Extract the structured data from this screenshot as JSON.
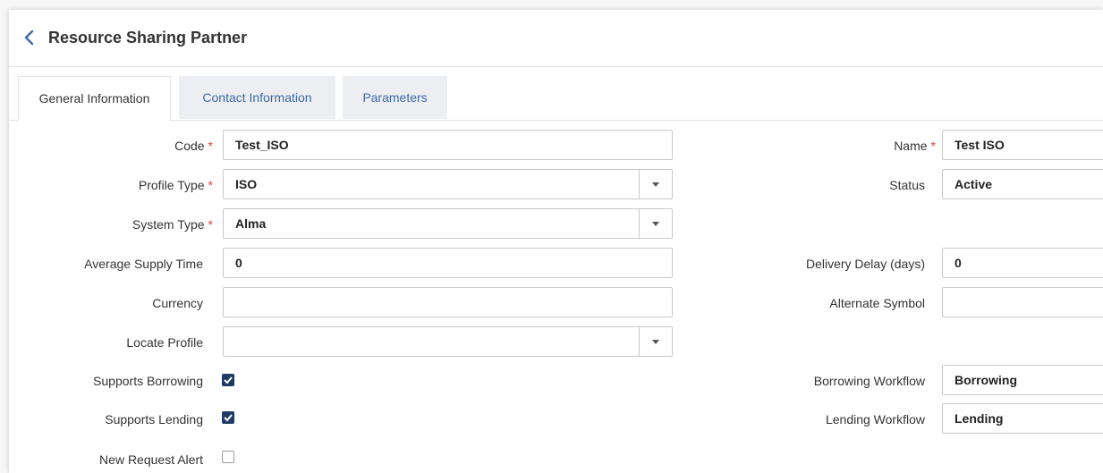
{
  "header": {
    "title": "Resource Sharing Partner"
  },
  "tabs": [
    {
      "label": "General Information"
    },
    {
      "label": "Contact Information"
    },
    {
      "label": "Parameters"
    }
  ],
  "form": {
    "code": {
      "label": "Code",
      "value": "Test_ISO"
    },
    "profile_type": {
      "label": "Profile Type",
      "value": "ISO"
    },
    "system_type": {
      "label": "System Type",
      "value": "Alma"
    },
    "average_supply_time": {
      "label": "Average Supply Time",
      "value": "0"
    },
    "currency": {
      "label": "Currency",
      "value": ""
    },
    "locate_profile": {
      "label": "Locate Profile",
      "value": ""
    },
    "supports_borrowing": {
      "label": "Supports Borrowing",
      "checked": true
    },
    "supports_lending": {
      "label": "Supports Lending",
      "checked": true
    },
    "new_request_alert": {
      "label": "New Request Alert",
      "checked": false
    },
    "name": {
      "label": "Name",
      "value": "Test ISO"
    },
    "status": {
      "label": "Status",
      "value": "Active"
    },
    "delivery_delay": {
      "label": "Delivery Delay (days)",
      "value": "0"
    },
    "alternate_symbol": {
      "label": "Alternate Symbol",
      "value": ""
    },
    "borrowing_workflow": {
      "label": "Borrowing Workflow",
      "value": "Borrowing"
    },
    "lending_workflow": {
      "label": "Lending Workflow",
      "value": "Lending"
    }
  },
  "colors": {
    "link": "#3f6aa5",
    "required": "#d9413f",
    "checkbox": "#1f3a66"
  }
}
